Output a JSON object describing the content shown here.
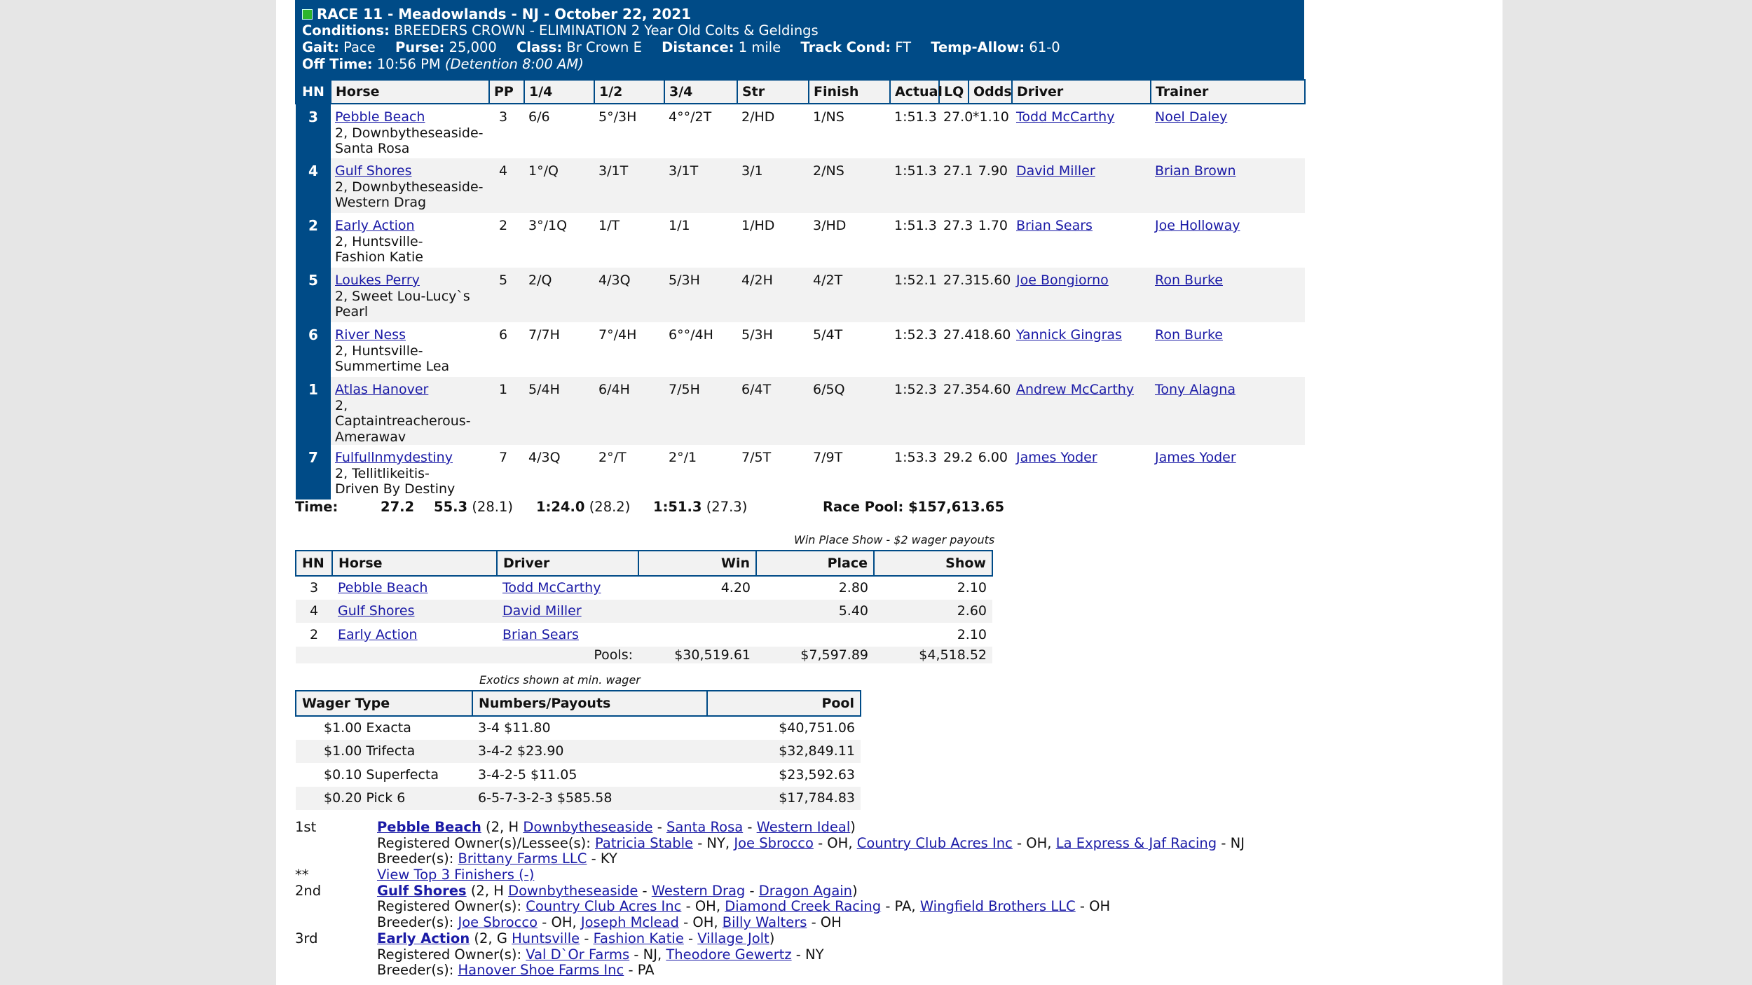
{
  "race": {
    "title": "RACE 11 - Meadowlands - NJ - October 22, 2021",
    "conditions_label": "Conditions:",
    "conditions": "BREEDERS CROWN - ELIMINATION 2 Year Old Colts & Geldings",
    "gait_label": "Gait:",
    "gait": "Pace",
    "purse_label": "Purse:",
    "purse": "25,000",
    "class_label": "Class:",
    "class": "Br Crown E",
    "distance_label": "Distance:",
    "distance": "1 mile",
    "track_label": "Track Cond:",
    "track": "FT",
    "temp_label": "Temp-Allow:",
    "temp": "61-0",
    "offtime_label": "Off Time:",
    "offtime": "10:56 PM",
    "detention": "(Detention 8:00 AM)"
  },
  "results": {
    "headers": [
      "HN",
      "Horse",
      "PP",
      "1/4",
      "1/2",
      "3/4",
      "Str",
      "Finish",
      "Actual",
      "LQ",
      "Odds",
      "Driver",
      "Trainer"
    ],
    "rows": [
      {
        "hn": "3",
        "horse": "Pebble Beach",
        "l2": "2, Downbytheseaside-",
        "l3": "Santa Rosa",
        "pp": "3",
        "q1": "6/6",
        "q2": "5°/3H",
        "q3": "4°°/2T",
        "str": "2/HD",
        "fin": "1/NS",
        "actual": "1:51.3",
        "lq": "27.0",
        "odds": "*1.10",
        "driver": "Todd McCarthy",
        "trainer": "Noel Daley"
      },
      {
        "hn": "4",
        "horse": "Gulf Shores",
        "l2": "2, Downbytheseaside-",
        "l3": "Western Drag",
        "pp": "4",
        "q1": "1°/Q",
        "q2": "3/1T",
        "q3": "3/1T",
        "str": "3/1",
        "fin": "2/NS",
        "actual": "1:51.3",
        "lq": "27.1",
        "odds": "7.90",
        "driver": "David Miller",
        "trainer": "Brian Brown"
      },
      {
        "hn": "2",
        "horse": "Early Action",
        "l2": "2, Huntsville-",
        "l3": "Fashion Katie",
        "pp": "2",
        "q1": "3°/1Q",
        "q2": "1/T",
        "q3": "1/1",
        "str": "1/HD",
        "fin": "3/HD",
        "actual": "1:51.3",
        "lq": "27.3",
        "odds": "1.70",
        "driver": "Brian Sears",
        "trainer": "Joe Holloway"
      },
      {
        "hn": "5",
        "horse": "Loukes Perry",
        "l2": "2, Sweet Lou-Lucy`s",
        "l3": "Pearl",
        "pp": "5",
        "q1": "2/Q",
        "q2": "4/3Q",
        "q3": "5/3H",
        "str": "4/2H",
        "fin": "4/2T",
        "actual": "1:52.1",
        "lq": "27.3",
        "odds": "15.60",
        "driver": "Joe Bongiorno",
        "trainer": "Ron Burke"
      },
      {
        "hn": "6",
        "horse": "River Ness",
        "l2": "2, Huntsville-",
        "l3": "Summertime Lea",
        "pp": "6",
        "q1": "7/7H",
        "q2": "7°/4H",
        "q3": "6°°/4H",
        "str": "5/3H",
        "fin": "5/4T",
        "actual": "1:52.3",
        "lq": "27.4",
        "odds": "18.60",
        "driver": "Yannick Gingras",
        "trainer": "Ron Burke"
      },
      {
        "hn": "1",
        "horse": "Atlas Hanover",
        "l2": "2, Captaintreacherous-",
        "l3": "Amerawav",
        "pp": "1",
        "q1": "5/4H",
        "q2": "6/4H",
        "q3": "7/5H",
        "str": "6/4T",
        "fin": "6/5Q",
        "actual": "1:52.3",
        "lq": "27.3",
        "odds": "54.60",
        "driver": "Andrew McCarthy",
        "trainer": "Tony Alagna"
      },
      {
        "hn": "7",
        "horse": "Fulfullnmydestiny",
        "l2": "2, Tellitlikeitis-",
        "l3": "Driven By Destiny",
        "pp": "7",
        "q1": "4/3Q",
        "q2": "2°/T",
        "q3": "2°/1",
        "str": "7/5T",
        "fin": "7/9T",
        "actual": "1:53.3",
        "lq": "29.2",
        "odds": "6.00",
        "driver": "James Yoder",
        "trainer": "James Yoder"
      }
    ]
  },
  "times": {
    "label": "Time:",
    "q1": "27.2",
    "q2": "55.3",
    "q2s": "(28.1)",
    "q3": "1:24.0",
    "q3s": "(28.2)",
    "fin": "1:51.3",
    "fins": "(27.3)",
    "pool": "Race Pool: $157,613.65"
  },
  "wps": {
    "caption": "Win Place Show - $2 wager payouts",
    "headers": [
      "HN",
      "Horse",
      "Driver",
      "Win",
      "Place",
      "Show"
    ],
    "rows": [
      {
        "hn": "3",
        "horse": "Pebble Beach",
        "driver": "Todd McCarthy",
        "win": "4.20",
        "place": "2.80",
        "show": "2.10"
      },
      {
        "hn": "4",
        "horse": "Gulf Shores",
        "driver": "David Miller",
        "win": "",
        "place": "5.40",
        "show": "2.60"
      },
      {
        "hn": "2",
        "horse": "Early Action",
        "driver": "Brian Sears",
        "win": "",
        "place": "",
        "show": "2.10"
      }
    ],
    "pools_label": "Pools:",
    "pool_win": "$30,519.61",
    "pool_place": "$7,597.89",
    "pool_show": "$4,518.52"
  },
  "exotics": {
    "caption": "Exotics shown at min. wager",
    "headers": [
      "Wager Type",
      "Numbers/Payouts",
      "Pool"
    ],
    "rows": [
      {
        "type": "$1.00 Exacta",
        "payout": "3-4 $11.80",
        "pool": "$40,751.06"
      },
      {
        "type": "$1.00 Trifecta",
        "payout": "3-4-2 $23.90",
        "pool": "$32,849.11"
      },
      {
        "type": "$0.10 Superfecta",
        "payout": "3-4-2-5 $11.05",
        "pool": "$23,592.63"
      },
      {
        "type": "$0.20 Pick 6",
        "payout": "6-5-7-3-2-3 $585.58",
        "pool": "$17,784.83"
      }
    ]
  },
  "finishers": {
    "first": {
      "place": "1st",
      "horse": "Pebble Beach",
      "info": "(2, H",
      "sire": "Downbytheseaside",
      "dam": "Santa Rosa",
      "damsire": "Western Ideal",
      "owners_label": "Registered Owner(s)/Lessee(s):",
      "owners": [
        [
          "Patricia Stable",
          "NY"
        ],
        [
          "Joe Sbrocco",
          "OH"
        ],
        [
          "Country Club Acres Inc",
          "OH"
        ],
        [
          "La Express & Jaf Racing",
          "NJ"
        ]
      ],
      "breeders_label": "Breeder(s):",
      "breeders": [
        [
          "Brittany Farms LLC",
          "KY"
        ]
      ]
    },
    "toggle_marker": "**",
    "toggle_label": "View Top 3 Finishers (-)",
    "second": {
      "place": "2nd",
      "horse": "Gulf Shores",
      "info": "(2, H",
      "sire": "Downbytheseaside",
      "dam": "Western Drag",
      "damsire": "Dragon Again",
      "owners_label": "Registered Owner(s):",
      "owners": [
        [
          "Country Club Acres Inc",
          "OH"
        ],
        [
          "Diamond Creek Racing",
          "PA"
        ],
        [
          "Wingfield Brothers LLC",
          "OH"
        ]
      ],
      "breeders_label": "Breeder(s):",
      "breeders": [
        [
          "Joe Sbrocco",
          "OH"
        ],
        [
          "Joseph Mclead",
          "OH"
        ],
        [
          "Billy Walters",
          "OH"
        ]
      ]
    },
    "third": {
      "place": "3rd",
      "horse": "Early Action",
      "info": "(2, G",
      "sire": "Huntsville",
      "dam": "Fashion Katie",
      "damsire": "Village Jolt",
      "owners_label": "Registered Owner(s):",
      "owners": [
        [
          "Val D`Or Farms",
          "NJ"
        ],
        [
          "Theodore Gewertz",
          "NY"
        ]
      ],
      "breeders_label": "Breeder(s):",
      "breeders": [
        [
          "Hanover Shoe Farms Inc",
          "PA"
        ]
      ]
    }
  }
}
